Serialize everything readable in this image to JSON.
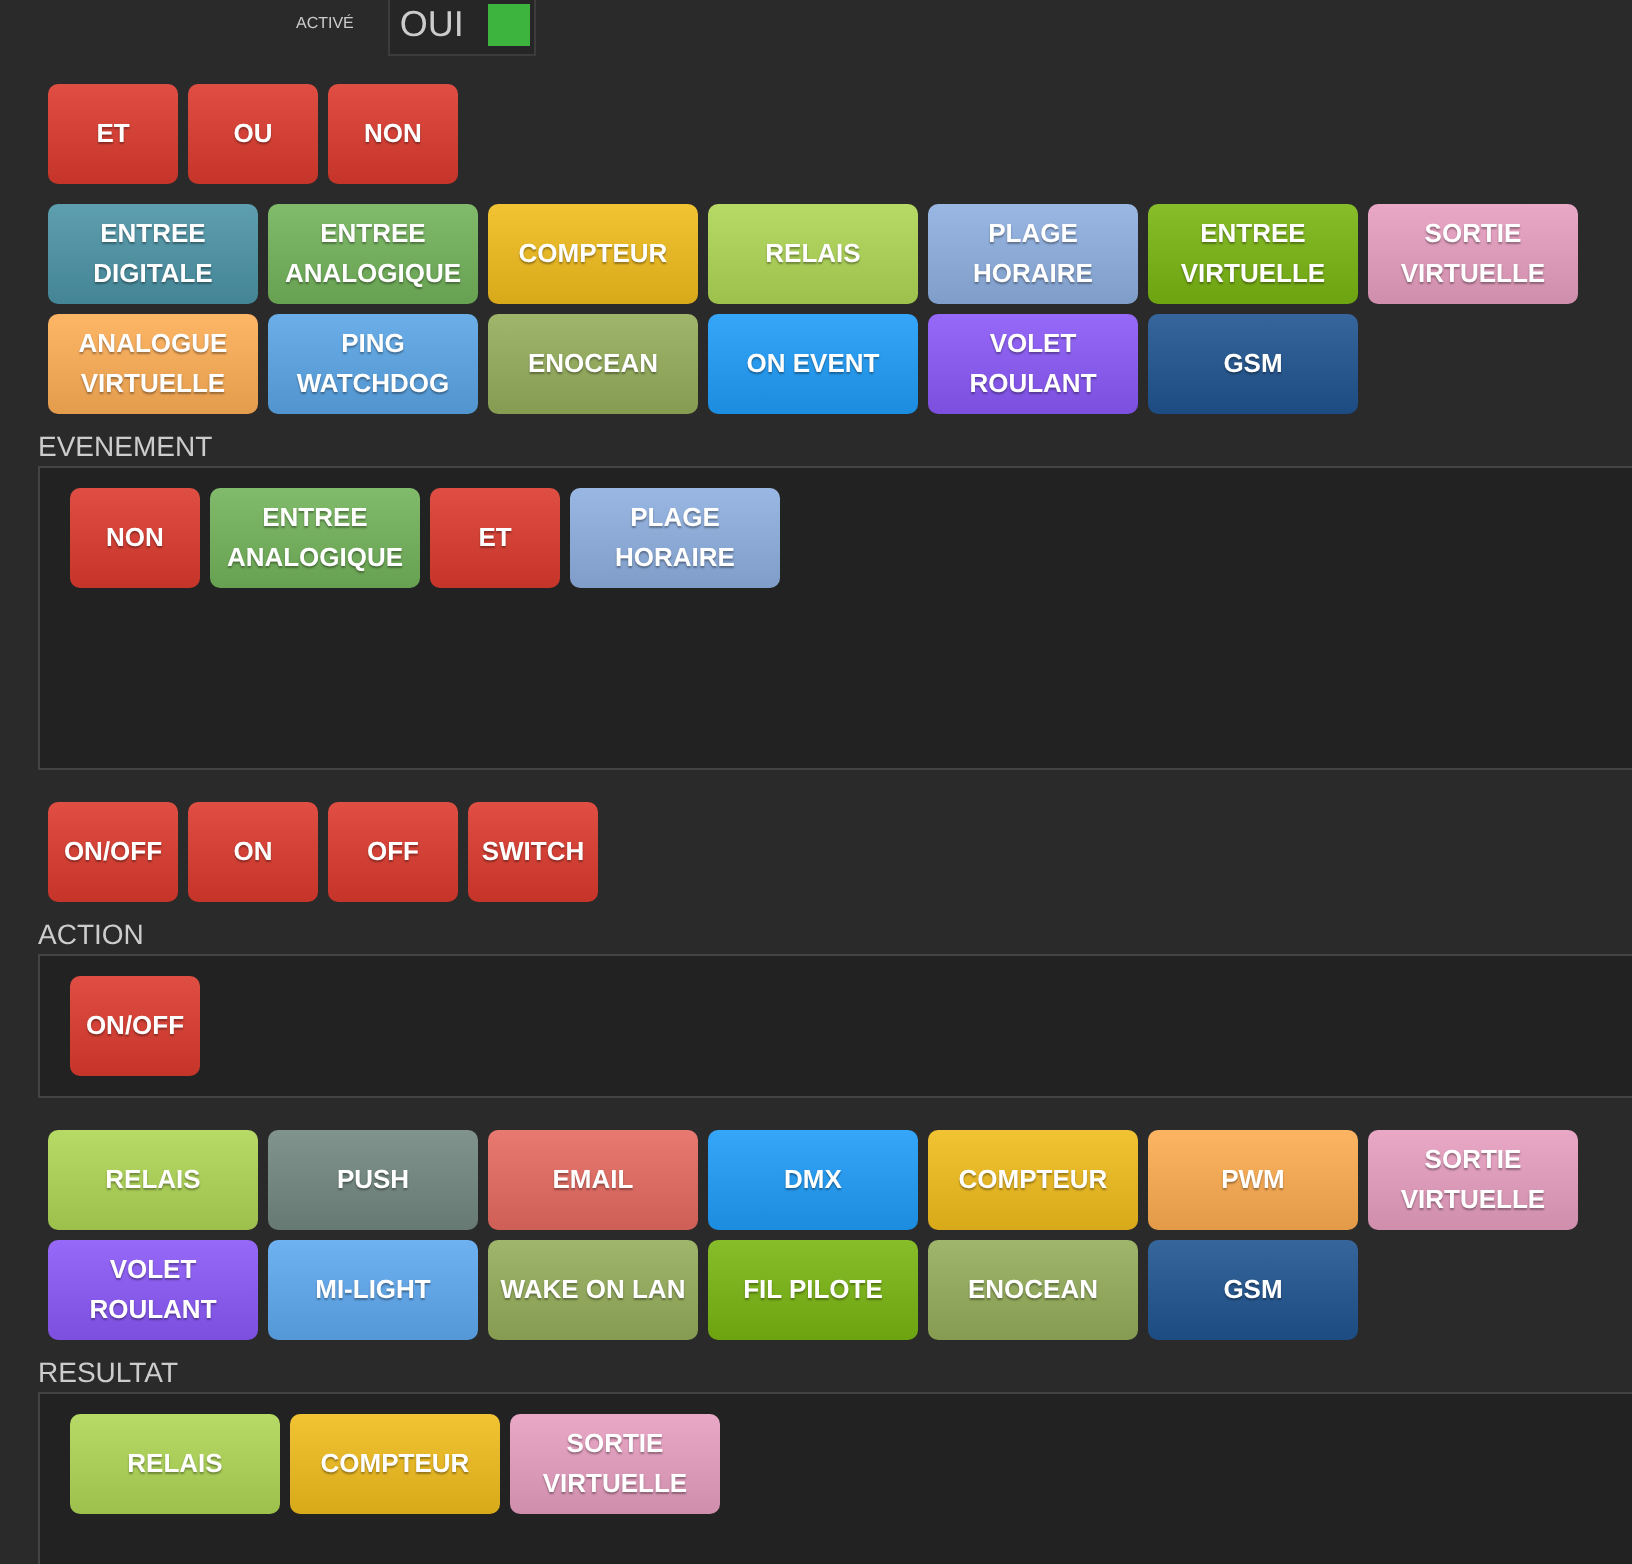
{
  "active": {
    "label": "ACTIVÉ",
    "value": "OUI",
    "on": true
  },
  "operators": [
    {
      "label": "ET",
      "color": "#dc3a2e",
      "kind": "operator"
    },
    {
      "label": "OU",
      "color": "#dc3a2e",
      "kind": "operator"
    },
    {
      "label": "NON",
      "color": "#dc3a2e",
      "kind": "operator"
    }
  ],
  "event_palette": [
    {
      "label": "ENTREE DIGITALE",
      "color": "#4b93a6",
      "kind": "module"
    },
    {
      "label": "ENTREE ANALOGIQUE",
      "color": "#72b35a",
      "kind": "module"
    },
    {
      "label": "COMPTEUR",
      "color": "#f0bc1c",
      "kind": "module"
    },
    {
      "label": "RELAIS",
      "color": "#aed654",
      "kind": "module"
    },
    {
      "label": "PLAGE HORAIRE",
      "color": "#8eafe0",
      "kind": "module"
    },
    {
      "label": "ENTREE VIRTUELLE",
      "color": "#7ab512",
      "kind": "module"
    },
    {
      "label": "SORTIE VIRTUELLE",
      "color": "#e79ec0",
      "kind": "module"
    },
    {
      "label": "ANALOGUE VIRTUELLE",
      "color": "#fdad55",
      "kind": "module"
    },
    {
      "label": "PING WATCHDOG",
      "color": "#5aa5e6",
      "kind": "module"
    },
    {
      "label": "ENOCEAN",
      "color": "#94ad5a",
      "kind": "module"
    },
    {
      "label": "ON EVENT",
      "color": "#1e9cf8",
      "kind": "module"
    },
    {
      "label": "VOLET ROULANT",
      "color": "#8a58f8",
      "kind": "module"
    },
    {
      "label": "GSM",
      "color": "#1f5490",
      "kind": "module"
    }
  ],
  "event": {
    "title": "EVENEMENT",
    "items": [
      {
        "label": "NON",
        "color": "#dc3a2e",
        "kind": "operator"
      },
      {
        "label": "ENTREE ANALOGIQUE",
        "color": "#72b35a",
        "kind": "module"
      },
      {
        "label": "ET",
        "color": "#dc3a2e",
        "kind": "operator"
      },
      {
        "label": "PLAGE HORAIRE",
        "color": "#8eafe0",
        "kind": "module"
      }
    ]
  },
  "action_operators": [
    {
      "label": "ON/OFF",
      "color": "#dc3a2e",
      "kind": "operator"
    },
    {
      "label": "ON",
      "color": "#dc3a2e",
      "kind": "operator"
    },
    {
      "label": "OFF",
      "color": "#dc3a2e",
      "kind": "operator"
    },
    {
      "label": "SWITCH",
      "color": "#dc3a2e",
      "kind": "operator"
    }
  ],
  "action": {
    "title": "ACTION",
    "items": [
      {
        "label": "ON/OFF",
        "color": "#dc3a2e",
        "kind": "operator"
      }
    ]
  },
  "action_palette": [
    {
      "label": "RELAIS",
      "color": "#aed654",
      "kind": "module"
    },
    {
      "label": "PUSH",
      "color": "#728780",
      "kind": "module"
    },
    {
      "label": "EMAIL",
      "color": "#e66a60",
      "kind": "module"
    },
    {
      "label": "DMX",
      "color": "#1e9cf8",
      "kind": "module"
    },
    {
      "label": "COMPTEUR",
      "color": "#f0bc1c",
      "kind": "module"
    },
    {
      "label": "PWM",
      "color": "#fdac50",
      "kind": "module"
    },
    {
      "label": "SORTIE VIRTUELLE",
      "color": "#e79ec0",
      "kind": "module"
    },
    {
      "label": "VOLET ROULANT",
      "color": "#8a58f8",
      "kind": "module"
    },
    {
      "label": "MI-LIGHT",
      "color": "#5ea9f0",
      "kind": "module"
    },
    {
      "label": "WAKE ON LAN",
      "color": "#94ad5a",
      "kind": "module"
    },
    {
      "label": "FIL PILOTE",
      "color": "#7ab512",
      "kind": "module"
    },
    {
      "label": "ENOCEAN",
      "color": "#94ad5a",
      "kind": "module"
    },
    {
      "label": "GSM",
      "color": "#1f5490",
      "kind": "module"
    }
  ],
  "result": {
    "title": "RESULTAT",
    "items": [
      {
        "label": "RELAIS",
        "color": "#aed654",
        "kind": "module"
      },
      {
        "label": "COMPTEUR",
        "color": "#f0bc1c",
        "kind": "module"
      },
      {
        "label": "SORTIE VIRTUELLE",
        "color": "#e79ec0",
        "kind": "module"
      }
    ]
  }
}
